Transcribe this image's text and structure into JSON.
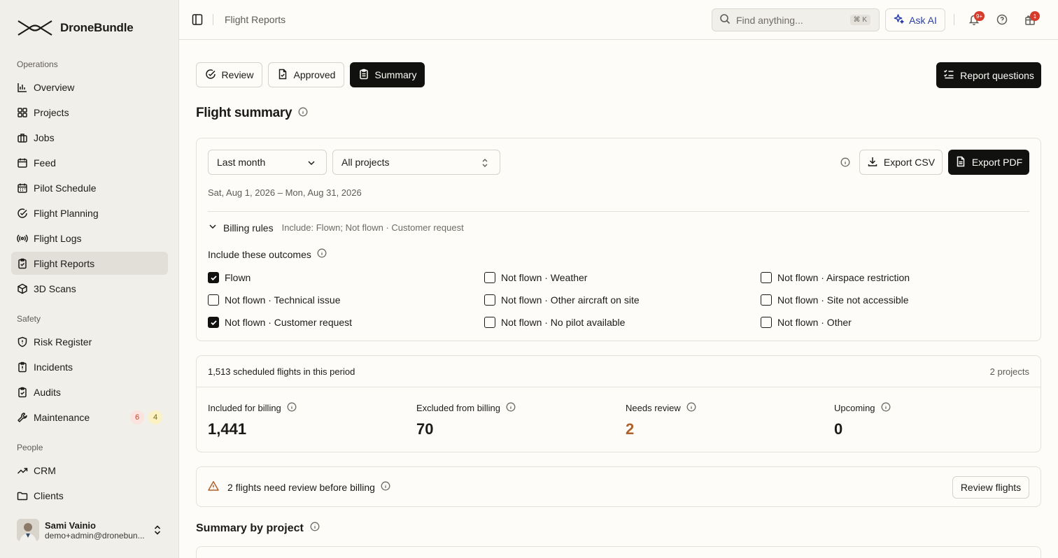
{
  "brand": {
    "name": "DroneBundle"
  },
  "sidebar": {
    "sections": [
      {
        "title": "Operations"
      },
      {
        "title": "Safety"
      },
      {
        "title": "People"
      }
    ],
    "items": [
      {
        "label": "Overview",
        "icon": "bar-chart-icon"
      },
      {
        "label": "Projects",
        "icon": "grid-icon"
      },
      {
        "label": "Jobs",
        "icon": "briefcase-icon"
      },
      {
        "label": "Feed",
        "icon": "calendar-icon"
      },
      {
        "label": "Pilot Schedule",
        "icon": "calendar-grid-icon"
      },
      {
        "label": "Flight Planning",
        "icon": "check-circle-icon"
      },
      {
        "label": "Flight Logs",
        "icon": "broadcast-icon"
      },
      {
        "label": "Flight Reports",
        "icon": "clipboard-check-icon",
        "active": true
      },
      {
        "label": "3D Scans",
        "icon": "cube-icon"
      },
      {
        "label": "Risk Register",
        "icon": "shield-icon"
      },
      {
        "label": "Incidents",
        "icon": "clipboard-icon"
      },
      {
        "label": "Audits",
        "icon": "clipboard-check-icon"
      },
      {
        "label": "Maintenance",
        "icon": "wrench-icon",
        "badges": [
          "6",
          "4"
        ]
      },
      {
        "label": "CRM",
        "icon": "trend-icon"
      },
      {
        "label": "Clients",
        "icon": "folder-icon"
      }
    ],
    "user": {
      "name": "Sami Vainio",
      "email": "demo+admin@dronebun..."
    }
  },
  "topbar": {
    "title": "Flight Reports",
    "search_placeholder": "Find anything...",
    "shortcut": "⌘ K",
    "ask_ai": "Ask AI",
    "notif_count": "9+",
    "gift_count": "1"
  },
  "tabs": [
    {
      "label": "Review",
      "active": false
    },
    {
      "label": "Approved",
      "active": false
    },
    {
      "label": "Summary",
      "active": true
    }
  ],
  "report_questions": "Report questions",
  "page_title": "Flight summary",
  "filters": {
    "period": "Last month",
    "projects": "All projects",
    "export_csv": "Export CSV",
    "export_pdf": "Export PDF",
    "date_range": "Sat, Aug 1, 2026 – Mon, Aug 31, 2026"
  },
  "billing": {
    "label": "Billing rules",
    "summary": "Include: Flown; Not flown · Customer request",
    "include_label": "Include these outcomes",
    "outcomes": [
      {
        "label": "Flown",
        "checked": true
      },
      {
        "label": "Not flown · Weather",
        "checked": false
      },
      {
        "label": "Not flown · Airspace restriction",
        "checked": false
      },
      {
        "label": "Not flown · Technical issue",
        "checked": false
      },
      {
        "label": "Not flown · Other aircraft on site",
        "checked": false
      },
      {
        "label": "Not flown · Site not accessible",
        "checked": false
      },
      {
        "label": "Not flown · Customer request",
        "checked": true
      },
      {
        "label": "Not flown · No pilot available",
        "checked": false
      },
      {
        "label": "Not flown · Other",
        "checked": false
      }
    ]
  },
  "stats": {
    "heading": "1,513 scheduled flights in this period",
    "projects": "2 projects",
    "items": [
      {
        "label": "Included for billing",
        "value": "1,441",
        "color": "#1c1b18"
      },
      {
        "label": "Excluded from billing",
        "value": "70",
        "color": "#1c1b18"
      },
      {
        "label": "Needs review",
        "value": "2",
        "color": "#b0602a"
      },
      {
        "label": "Upcoming",
        "value": "0",
        "color": "#1c1b18"
      }
    ]
  },
  "review_banner": {
    "text": "2 flights need review before billing",
    "button": "Review flights"
  },
  "section_title": "Summary by project",
  "colors": {
    "accent": "#111110",
    "warning": "#b0602a",
    "sidebar_bg": "#f1efea",
    "page_bg": "#fdfcf8"
  }
}
